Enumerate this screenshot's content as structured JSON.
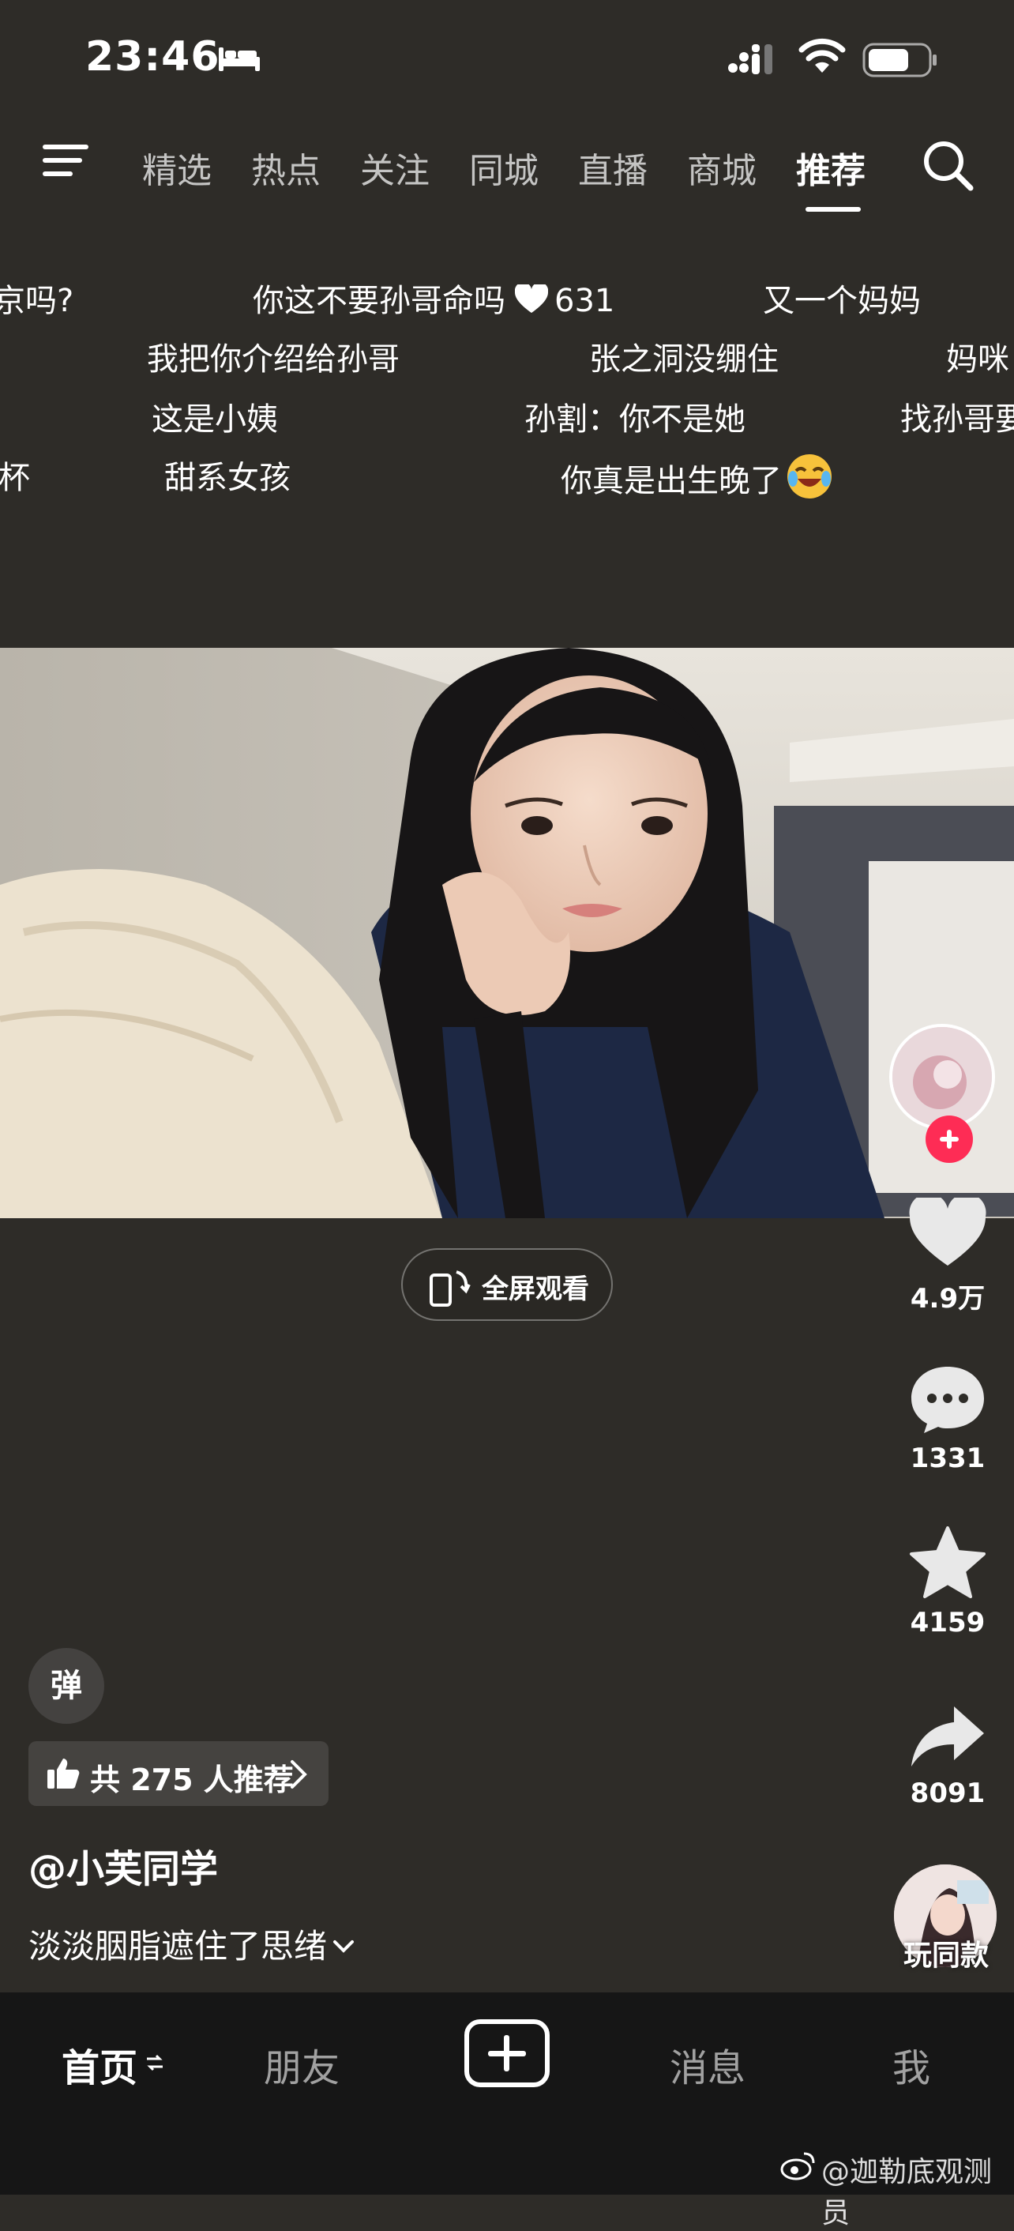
{
  "status_bar": {
    "time": "23:46"
  },
  "top_nav": {
    "tabs": [
      {
        "label": "精选"
      },
      {
        "label": "热点"
      },
      {
        "label": "关注"
      },
      {
        "label": "同城"
      },
      {
        "label": "直播"
      },
      {
        "label": "商城"
      },
      {
        "label": "推荐",
        "active": true
      }
    ]
  },
  "danmu": [
    {
      "text": "京吗?"
    },
    {
      "text": "你这不要孙哥命吗"
    },
    {
      "text": "631"
    },
    {
      "text": "又一个妈妈"
    },
    {
      "text": "我把你介绍给孙哥"
    },
    {
      "text": "张之洞没绷住"
    },
    {
      "text": "妈咪"
    },
    {
      "text": "这是小姨"
    },
    {
      "text": "孙割：你不是她"
    },
    {
      "text": "找孙哥要"
    },
    {
      "text": "杯"
    },
    {
      "text": "甜系女孩"
    },
    {
      "text": "你真是出生晚了"
    }
  ],
  "fullscreen_button": {
    "label": "全屏观看"
  },
  "side_rail": {
    "likes": "4.9万",
    "comments": "1331",
    "favorites": "4159",
    "shares": "8091"
  },
  "danmu_toggle": {
    "label": "弹"
  },
  "recommend_chip": {
    "label": "共 275 人推荐"
  },
  "author": {
    "handle": "@小芙同学"
  },
  "caption": {
    "text": "淡淡胭脂遮住了思绪"
  },
  "play_same": {
    "label": "玩同款"
  },
  "bottom_tabs": {
    "home": "首页",
    "friends": "朋友",
    "messages": "消息",
    "me": "我"
  },
  "watermark": {
    "text": "@迦勒底观测员"
  },
  "colors": {
    "background": "#2e2c28",
    "accent": "#fe2c55",
    "bottom_bar": "#161616"
  }
}
